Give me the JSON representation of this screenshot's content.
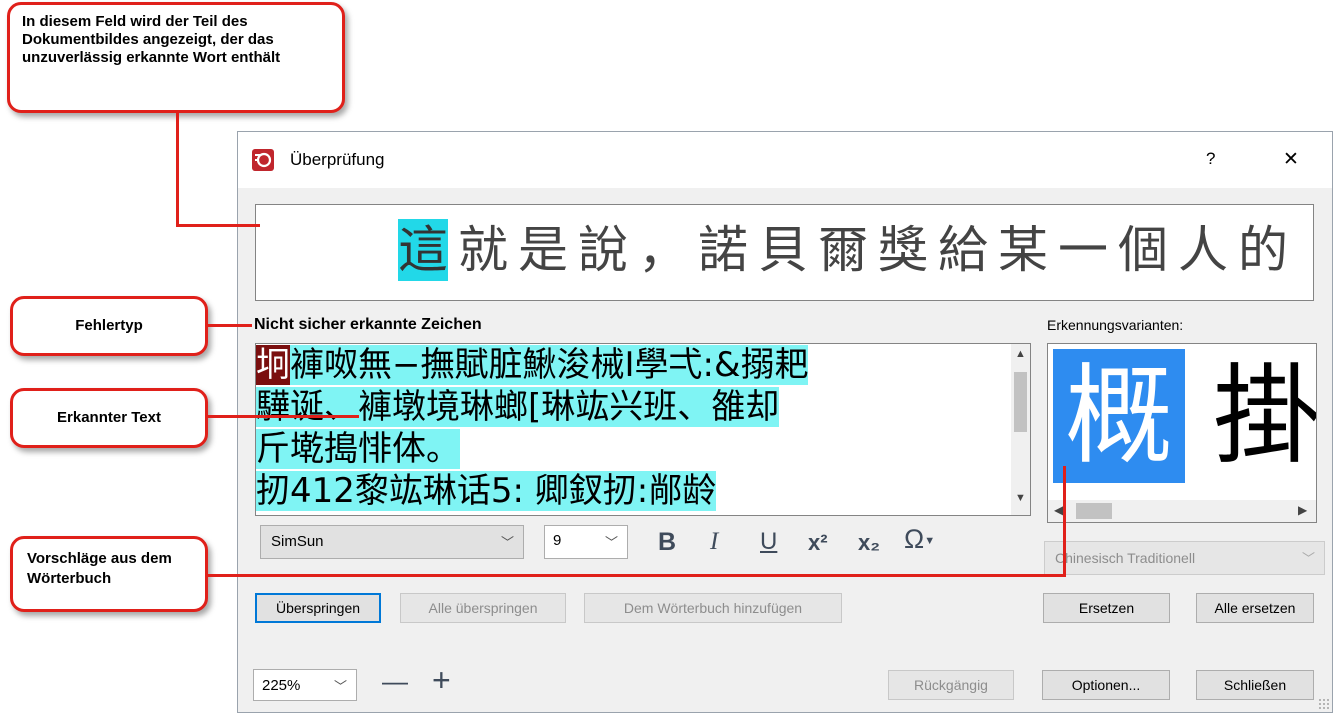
{
  "callouts": {
    "image_field": "In diesem Feld wird der Teil des Dokumentbildes angezeigt, der das unzuverlässig erkannte Wort enthält",
    "error_type": "Fehlertyp",
    "recognized_text": "Erkannter Text",
    "dictionary_suggestions": "Vorschläge aus dem Wörterbuch"
  },
  "dialog": {
    "title": "Überprüfung",
    "help": "?",
    "close": "✕",
    "image_strip_chars": [
      "這",
      "就",
      "是",
      "說",
      "，",
      "諾",
      "貝",
      "爾",
      "獎",
      "給",
      "某",
      "一",
      "個",
      "人",
      "的"
    ],
    "error_type_label": "Nicht sicher erkannte Zeichen",
    "variants_label": "Erkennungsvarianten:",
    "text_lines": [
      {
        "first": "坰",
        "rest": "褲呶無−撫賦脏鰍浚械I學弌:&搦耙"
      },
      {
        "first": "",
        "rest": "驊诞、褲墩境琳螂[琳竑兴班、雒却"
      },
      {
        "first": "",
        "rest": "斤墘搗悱体。"
      },
      {
        "first": "",
        "rest": "扨412黎竑琳话5:     卿釵扨:䣊龄"
      }
    ],
    "variants": [
      "概",
      "掛"
    ],
    "font_name": "SimSun",
    "font_size": "9",
    "format": {
      "bold": "B",
      "italic": "I",
      "underline": "U",
      "superscript": "x²",
      "subscript": "x₂",
      "symbol": "Ω"
    },
    "language": "Chinesisch Traditionell",
    "buttons": {
      "skip": "Überspringen",
      "skip_all": "Alle überspringen",
      "add_dict": "Dem Wörterbuch hinzufügen",
      "replace": "Ersetzen",
      "replace_all": "Alle ersetzen",
      "undo": "Rückgängig",
      "options": "Optionen...",
      "close": "Schließen"
    },
    "zoom": "225%",
    "zoom_out": "—",
    "zoom_in": "+"
  }
}
